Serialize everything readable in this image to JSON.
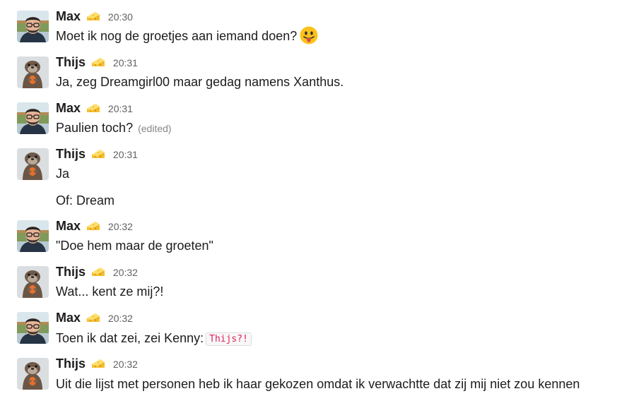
{
  "messages": [
    {
      "sender": "Max",
      "time": "20:30",
      "text": "Moet ik nog de groetjes aan iemand doen?",
      "emoji": "stuck-out-tongue-emoji"
    },
    {
      "sender": "Thijs",
      "time": "20:31",
      "text": "Ja, zeg Dreamgirl00 maar gedag namens Xanthus."
    },
    {
      "sender": "Max",
      "time": "20:31",
      "text": "Paulien toch?",
      "edited_label": "(edited)"
    },
    {
      "sender": "Thijs",
      "time": "20:31",
      "text": "Ja",
      "continuation_text": "Of: Dream"
    },
    {
      "sender": "Max",
      "time": "20:32",
      "text": "\"Doe hem maar de groeten\""
    },
    {
      "sender": "Thijs",
      "time": "20:32",
      "text": "Wat... kent ze mij?!"
    },
    {
      "sender": "Max",
      "time": "20:32",
      "text": "Toen ik dat zei, zei Kenny:",
      "code": "Thijs?!"
    },
    {
      "sender": "Thijs",
      "time": "20:32",
      "text": "Uit die lijst met personen heb ik haar gekozen omdat ik verwachtte dat zij mij niet zou kennen"
    }
  ],
  "icons": {
    "status_emoji": "cheese-icon",
    "max_avatar": "man-with-glasses-avatar",
    "thijs_avatar": "otter-avatar"
  }
}
